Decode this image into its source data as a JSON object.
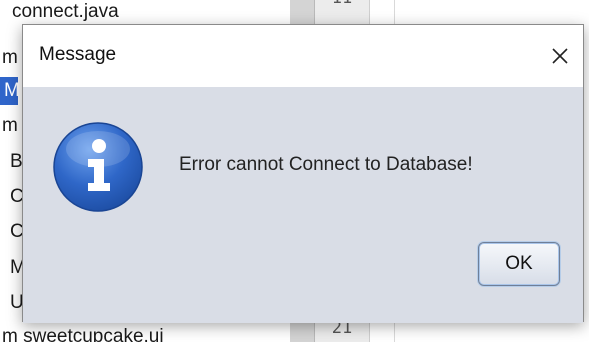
{
  "background": {
    "tree_rows": [
      "connect.java",
      "m",
      "M",
      "m",
      "B",
      "C",
      "C",
      "M",
      "U",
      "m sweetcupcake.ui"
    ],
    "line_numbers": [
      "11",
      "21"
    ]
  },
  "dialog": {
    "title": "Message",
    "message": "Error cannot Connect to Database!",
    "ok_label": "OK",
    "icon": "info-icon",
    "close_icon": "close-icon"
  },
  "colors": {
    "dialog_bg": "#d9dde6",
    "titlebar_bg": "#ffffff",
    "icon_blue": "#2f67c8",
    "selection": "#2f65ca"
  }
}
